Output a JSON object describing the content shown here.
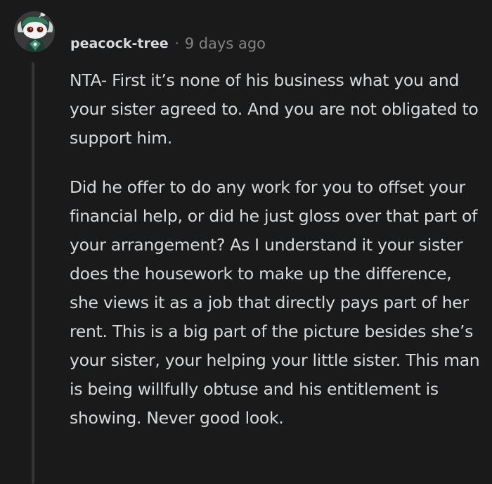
{
  "comment": {
    "author": "peacock-tree",
    "separator": "·",
    "timestamp": "9 days ago",
    "avatar_icon": "snoo-avatar-icon",
    "paragraphs": [
      "NTA- First it’s none of his business what you and your sister agreed to. And you are not obligated to support him.",
      "Did he offer to do any work for you to offset your financial help, or did he just gloss over that part of your arrangement? As I understand it your sister does the housework to make up the difference, she views it as a job that directly pays part of her rent. This is a big part of the picture besides she’s your sister, your helping your little sister. This man is being willfully obtuse and his entitlement is showing. Never good look."
    ]
  },
  "colors": {
    "background": "#1a1a1b",
    "text": "#d7dadc",
    "meta": "#818384",
    "thread_line": "#343536"
  }
}
